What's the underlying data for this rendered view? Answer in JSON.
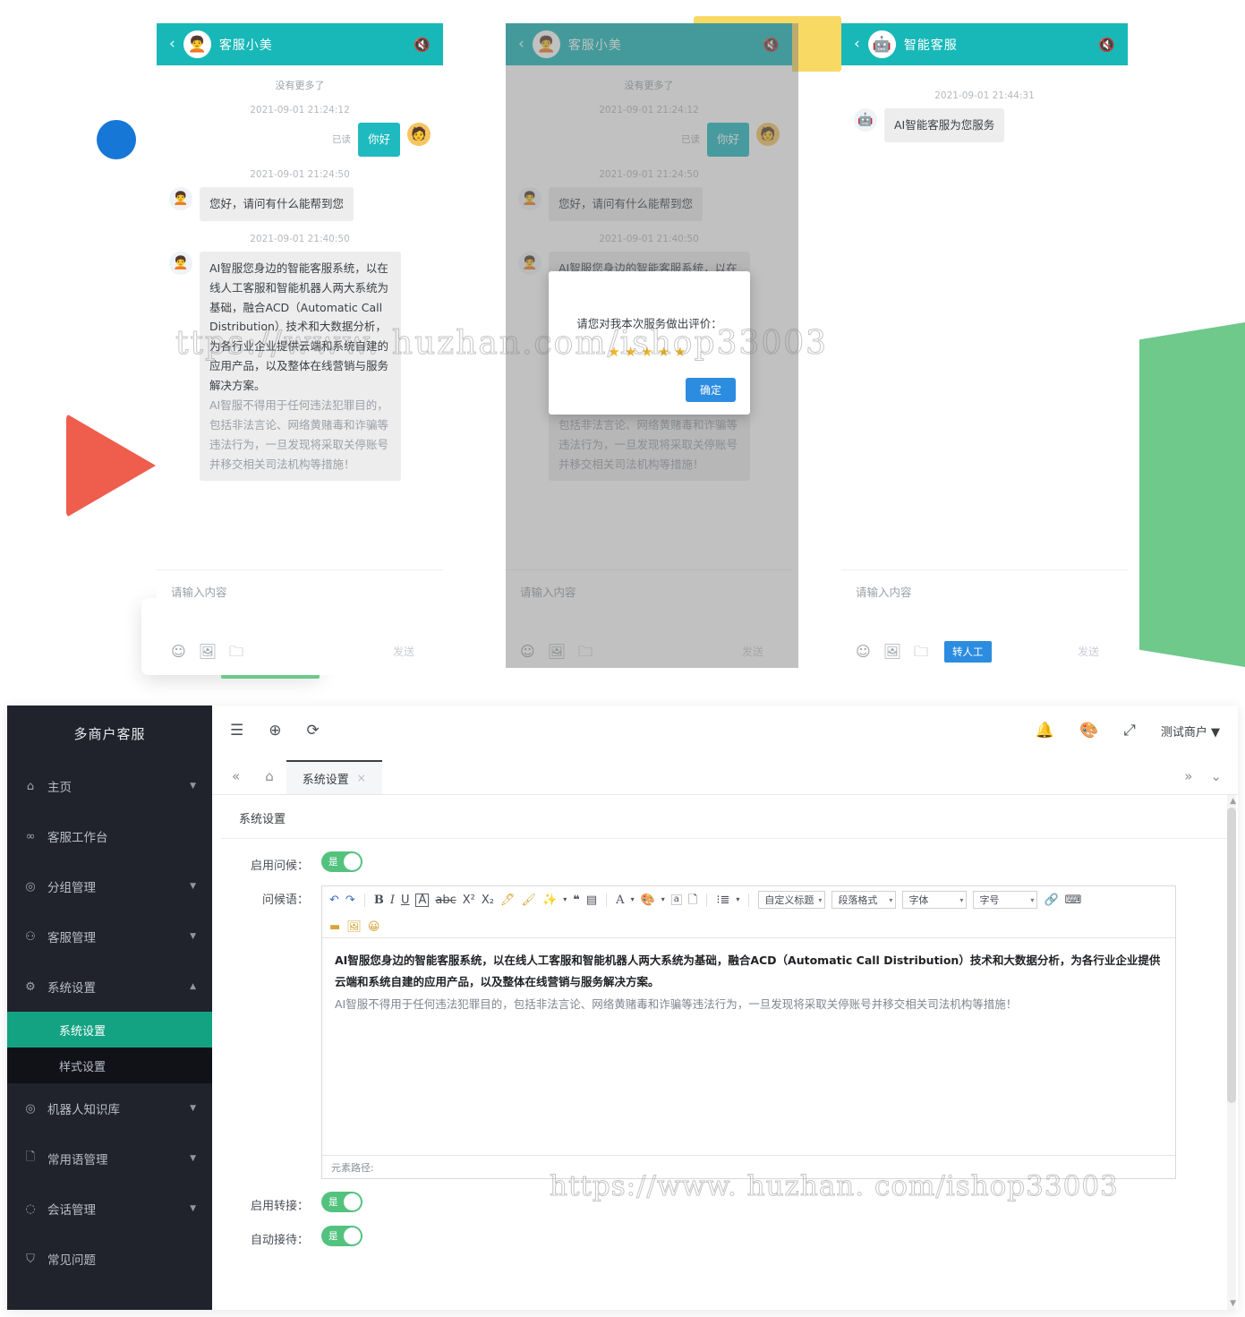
{
  "watermark": {
    "top": "ttps://www. huzhan.com/ishop33003",
    "bottom": "https://www. huzhan. com/ishop33003"
  },
  "chat_panels": [
    {
      "title": "客服小美",
      "back_icon": "chevron-left-icon",
      "avatar_icon": "agent-avatar-icon",
      "mute_icon": "speaker-mute-icon",
      "sys_note": "没有更多了",
      "messages": [
        {
          "ts": "2021-09-01 21:24:12",
          "side": "out",
          "text": "你好",
          "read_flag": "已读"
        },
        {
          "ts": "2021-09-01 21:24:50",
          "side": "in",
          "text": "您好，请问有什么能帮到您"
        },
        {
          "ts": "2021-09-01 21:40:50",
          "side": "in",
          "text": "AI智服您身边的智能客服系统，以在线人工客服和智能机器人两大系统为基础，融合ACD（Automatic Call Distribution）技术和大数据分析，为各行业企业提供云端和系统自建的应用产品，以及整体在线营销与服务解决方案。",
          "text2": "AI智服不得用于任何违法犯罪目的，包括非法言论、网络黄赌毒和诈骗等违法行为，一旦发现将采取关停账号并移交相关司法机构等措施！"
        }
      ],
      "input_placeholder": "请输入内容",
      "tools": [
        "emoji-icon",
        "image-icon",
        "folder-icon"
      ],
      "send_label": "发送",
      "transfer_label": null
    },
    {
      "title": "客服小美",
      "back_icon": "chevron-left-icon",
      "avatar_icon": "agent-avatar-icon",
      "mute_icon": "speaker-mute-icon",
      "sys_note": "没有更多了",
      "messages": [
        {
          "ts": "2021-09-01 21:24:12",
          "side": "out",
          "text": "你好",
          "read_flag": "已读"
        },
        {
          "ts": "2021-09-01 21:24:50",
          "side": "in",
          "text": "您好，请问有什么能帮到您"
        },
        {
          "ts": "2021-09-01 21:40:50",
          "side": "in",
          "text": "AI智服您身边的智能客服系统，以在线人工客服和智能机器人两大系统为基础，融合ACD（Automatic Call Distribution）技术和大数据分析，为各行业企业提供云端和系统自建的应用产品，以及整体在线营销与服务解决方案。",
          "text2": "AI智服不得用于任何违法犯罪目的，包括非法言论、网络黄赌毒和诈骗等违法行为，一旦发现将采取关停账号并移交相关司法机构等措施！"
        }
      ],
      "input_placeholder": "请输入内容",
      "tools": [
        "emoji-icon",
        "image-icon",
        "folder-icon"
      ],
      "send_label": "发送",
      "transfer_label": null
    },
    {
      "title": "智能客服",
      "back_icon": "chevron-left-icon",
      "avatar_icon": "robot-avatar-icon",
      "mute_icon": "speaker-mute-icon",
      "sys_note": "",
      "messages": [
        {
          "ts": "2021-09-01 21:44:31",
          "side": "in",
          "text": "AI智能客服为您服务"
        }
      ],
      "input_placeholder": "请输入内容",
      "tools": [
        "emoji-icon",
        "image-icon",
        "folder-icon"
      ],
      "send_label": "发送",
      "transfer_label": "转人工"
    }
  ],
  "rating_modal": {
    "question": "请您对我本次服务做出评价：",
    "stars": "★★★★★",
    "confirm_label": "确定"
  },
  "admin": {
    "sidebar": {
      "logo": "多商户客服",
      "items": [
        {
          "label": "主页",
          "icon": "home-icon",
          "arrow": "▼"
        },
        {
          "label": "客服工作台",
          "icon": "headset-icon",
          "arrow": ""
        },
        {
          "label": "分组管理",
          "icon": "cube-icon",
          "arrow": "▼"
        },
        {
          "label": "客服管理",
          "icon": "user-icon",
          "arrow": "▼"
        },
        {
          "label": "系统设置",
          "icon": "gear-icon",
          "arrow": "▲"
        }
      ],
      "sub_items": [
        {
          "label": "系统设置",
          "active": true
        },
        {
          "label": "样式设置",
          "active": false
        }
      ],
      "items_after": [
        {
          "label": "机器人知识库",
          "icon": "cube-icon",
          "arrow": "▼"
        },
        {
          "label": "常用语管理",
          "icon": "note-icon",
          "arrow": "▼"
        },
        {
          "label": "会话管理",
          "icon": "chat-icon",
          "arrow": "▼"
        },
        {
          "label": "常见问题",
          "icon": "shield-icon",
          "arrow": ""
        }
      ]
    },
    "topbar": {
      "icons": [
        "menu-fold-icon",
        "globe-icon",
        "refresh-icon"
      ],
      "right_icons": [
        "bell-icon",
        "theme-icon",
        "fullscreen-icon"
      ],
      "user": "测试商户",
      "user_caret": "▼"
    },
    "tabbar": {
      "collapse_icon": "double-chevron-left-icon",
      "home_icon": "home-outline-icon",
      "tab_label": "系统设置",
      "tab_close": "×",
      "more_icon": "double-chevron-right-icon",
      "dropdown_icon": "chevron-down-icon"
    },
    "content": {
      "panel_title": "系统设置",
      "fields": [
        {
          "label": "启用问候：",
          "value": "是"
        },
        {
          "label": "启用转接：",
          "value": "是"
        },
        {
          "label": "自动接待：",
          "value": "是"
        }
      ],
      "editor": {
        "label": "问候语：",
        "toolbar_icons": [
          "undo-icon",
          "redo-icon",
          "bold-icon",
          "italic-icon",
          "underline-icon",
          "font-box-icon",
          "strikethrough-icon",
          "superscript-icon",
          "subscript-icon",
          "eraser-icon",
          "format-brush-icon",
          "magic-wand-icon",
          "quote-icon",
          "table-icon",
          "text-color-icon",
          "bg-color-icon",
          "link-icon",
          "page-icon",
          "list-icon"
        ],
        "toolbar_icons_row2": [
          "media-icon",
          "image-upload-icon",
          "emoji-icon"
        ],
        "selects": [
          {
            "label": "自定义标题"
          },
          {
            "label": "段落格式"
          },
          {
            "label": "字体"
          },
          {
            "label": "字号"
          }
        ],
        "trailing_icons": [
          "attach-icon",
          "code-icon"
        ],
        "content_bold": "AI智服您身边的智能客服系统，以在线人工客服和智能机器人两大系统为基础，融合ACD（Automatic Call Distribution）技术和大数据分析，为各行业企业提供云端和系统自建的应用产品，以及整体在线营销与服务解决方案。",
        "content_plain": "AI智服不得用于任何违法犯罪目的，包括非法言论、网络黄赌毒和诈骗等违法行为，一旦发现将采取关停账号并移交相关司法机构等措施！",
        "status_label": "元素路径:"
      }
    }
  },
  "colors": {
    "chat_header": "#18b8b8",
    "bubble_out": "#1fbac0",
    "accent_blue": "#2c8ce0",
    "sidebar_bg": "#20222c",
    "sidebar_active": "#13a383",
    "toggle_on": "#53c27f",
    "deco_yellow": "#f8d964",
    "deco_green": "#6ec98b",
    "deco_red": "#ef5d4d",
    "deco_blue": "#1677d6"
  }
}
